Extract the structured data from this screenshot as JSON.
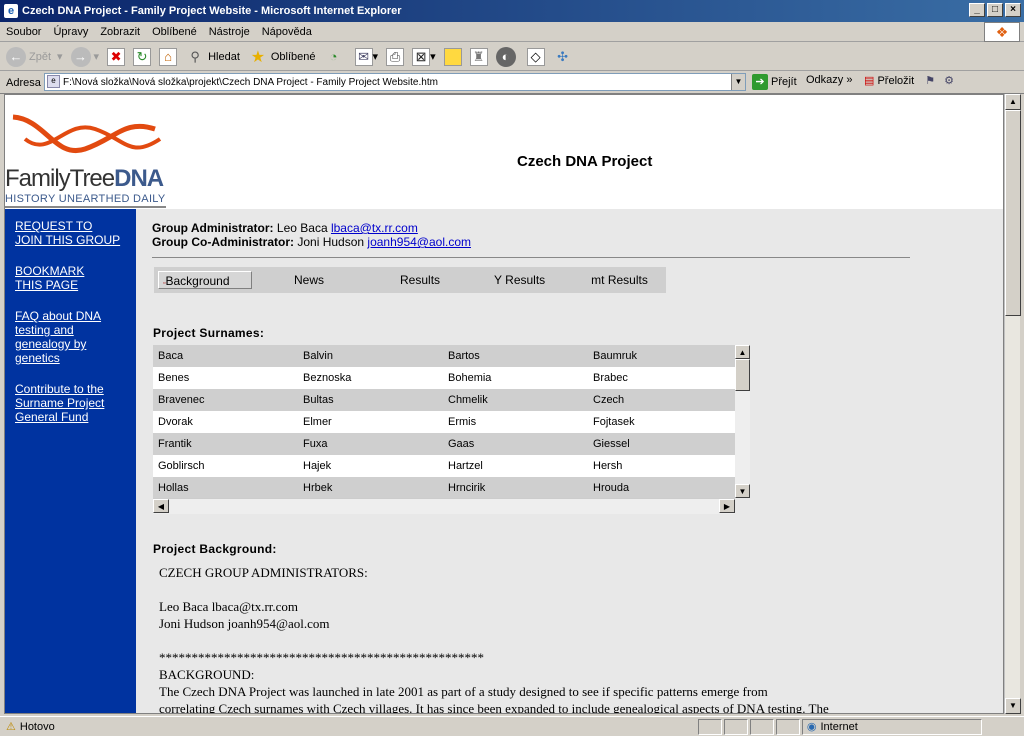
{
  "window": {
    "title": "Czech DNA Project - Family Project Website - Microsoft Internet Explorer",
    "buttons": [
      "_",
      "□",
      "×"
    ]
  },
  "menu": [
    "Soubor",
    "Úpravy",
    "Zobrazit",
    "Oblíbené",
    "Nástroje",
    "Nápověda"
  ],
  "toolbar": {
    "back": "Zpět",
    "search": "Hledat",
    "favorites": "Oblíbené"
  },
  "address": {
    "label": "Adresa",
    "value": "F:\\Nová složka\\Nová složka\\projekt\\Czech DNA Project - Family Project Website.htm",
    "go": "Přejít",
    "links": "Odkazy",
    "translate": "Přeložit"
  },
  "page": {
    "logo": {
      "family": "Family",
      "tree": "Tree",
      "dna": "DNA",
      "tagline": "HISTORY UNEARTHED DAILY"
    },
    "title": "Czech DNA Project",
    "sidebar": [
      "REQUEST TO JOIN THIS GROUP",
      "BOOKMARK THIS PAGE",
      "FAQ about DNA testing and genealogy by genetics",
      "Contribute to the Surname Project General Fund"
    ],
    "admin": {
      "label": "Group Administrator:",
      "name": "Leo Baca",
      "email": "lbaca@tx.rr.com",
      "co_label": "Group Co-Administrator:",
      "co_name": "Joni Hudson",
      "co_email": "joanh954@aol.com"
    },
    "tabs": [
      "Background",
      "News",
      "Results",
      "Y Results",
      "mt Results"
    ],
    "surnames_label": "Project Surnames:",
    "surnames": [
      [
        "Baca",
        "Balvin",
        "Bartos",
        "Baumruk"
      ],
      [
        "Benes",
        "Beznoska",
        "Bohemia",
        "Brabec"
      ],
      [
        "Bravenec",
        "Bultas",
        "Chmelik",
        "Czech"
      ],
      [
        "Dvorak",
        "Elmer",
        "Ermis",
        "Fojtasek"
      ],
      [
        "Frantik",
        "Fuxa",
        "Gaas",
        "Giessel"
      ],
      [
        "Goblirsch",
        "Hajek",
        "Hartzel",
        "Hersh"
      ],
      [
        "Hollas",
        "Hrbek",
        "Hrncirik",
        "Hrouda"
      ]
    ],
    "background_label": "Project Background:",
    "background_lines": [
      "CZECH GROUP ADMINISTRATORS:",
      "",
      "Leo Baca lbaca@tx.rr.com",
      "Joni Hudson joanh954@aol.com",
      "",
      "**************************************************",
      "BACKGROUND:",
      "The Czech DNA Project was launched in late 2001 as part of a study designed to see if specific patterns emerge from",
      "correlating Czech surnames with Czech villages. It has since been expanded to include genealogical aspects of DNA testing. The"
    ]
  },
  "status": {
    "left": "Hotovo",
    "zone": "Internet"
  }
}
